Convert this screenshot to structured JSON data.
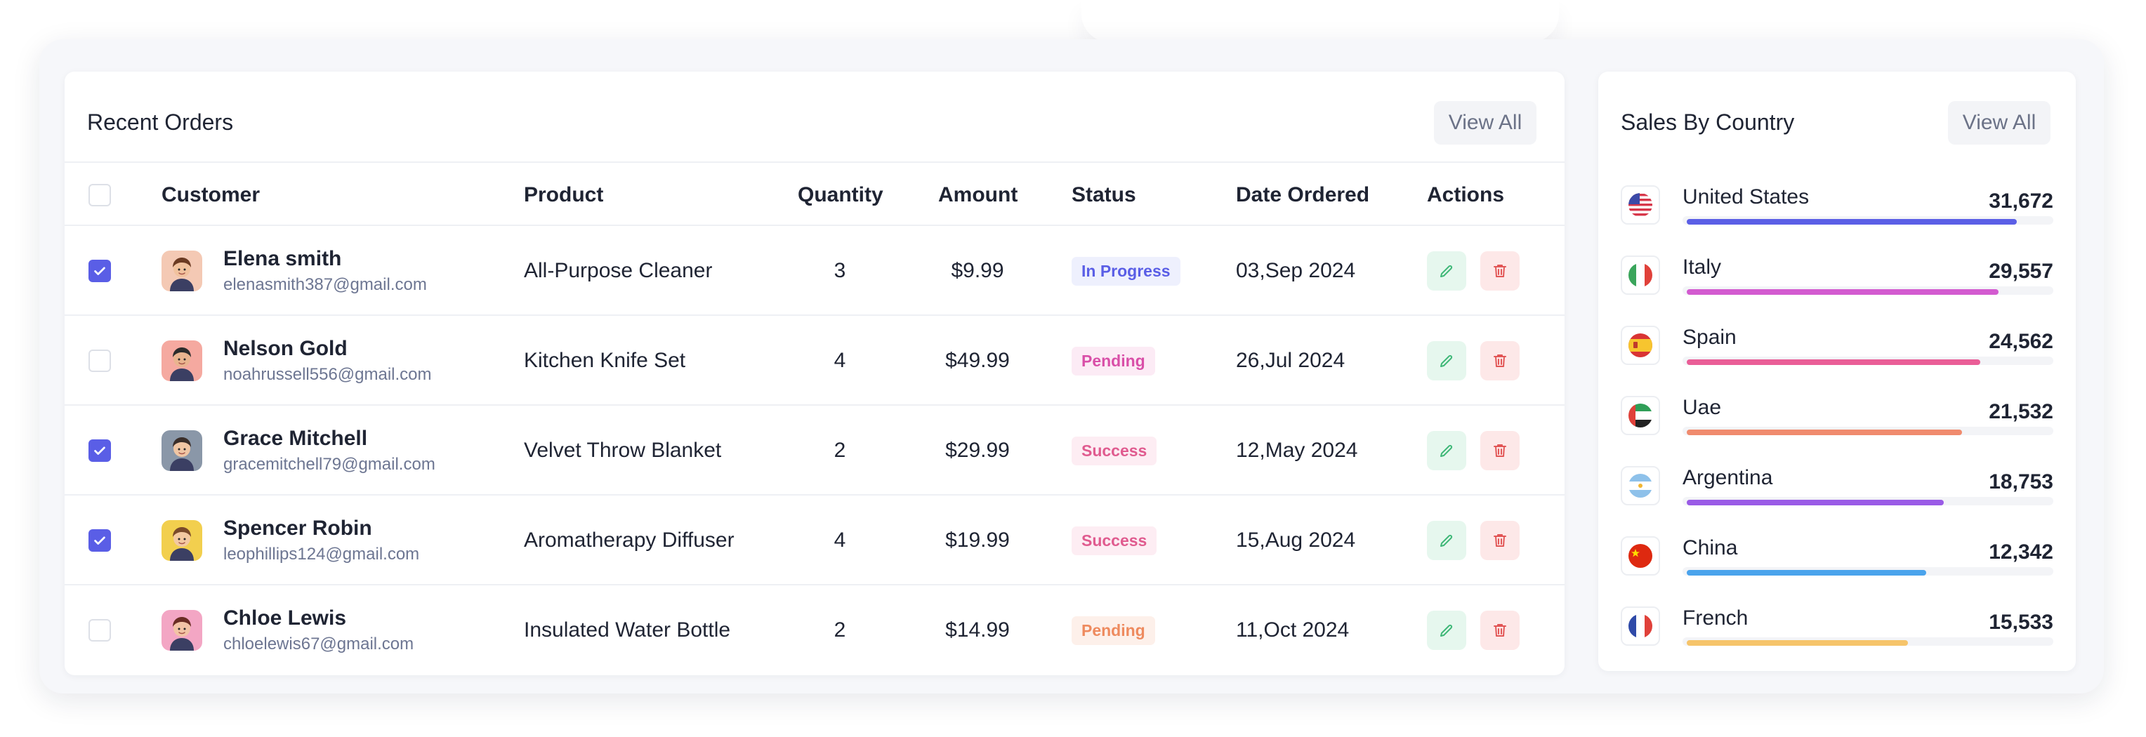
{
  "orders": {
    "title": "Recent Orders",
    "view_all": "View All",
    "columns": {
      "customer": "Customer",
      "product": "Product",
      "quantity": "Quantity",
      "amount": "Amount",
      "status": "Status",
      "date": "Date Ordered",
      "actions": "Actions"
    },
    "rows": [
      {
        "checked": true,
        "name": "Elena smith",
        "email": "elenasmith387@gmail.com",
        "product": "All-Purpose Cleaner",
        "quantity": "3",
        "amount": "$9.99",
        "status": "In Progress",
        "status_color": "#5a5ee6",
        "status_bg": "#eef0fd",
        "date": "03,Sep 2024",
        "avatar_bg": "#f4c9b4"
      },
      {
        "checked": false,
        "name": "Nelson Gold",
        "email": "noahrussell556@gmail.com",
        "product": "Kitchen Knife Set",
        "quantity": "4",
        "amount": "$49.99",
        "status": "Pending",
        "status_color": "#d94fa8",
        "status_bg": "#fcebf5",
        "date": "26,Jul 2024",
        "avatar_bg": "#f5a9a0"
      },
      {
        "checked": true,
        "name": "Grace Mitchell",
        "email": "gracemitchell79@gmail.com",
        "product": "Velvet Throw Blanket",
        "quantity": "2",
        "amount": "$29.99",
        "status": "Success",
        "status_color": "#e05b8f",
        "status_bg": "#fdedf3",
        "date": "12,May 2024",
        "avatar_bg": "#8a97a8"
      },
      {
        "checked": true,
        "name": "Spencer Robin",
        "email": "leophillips124@gmail.com",
        "product": "Aromatherapy Diffuser",
        "quantity": "4",
        "amount": "$19.99",
        "status": "Success",
        "status_color": "#e05b8f",
        "status_bg": "#fdedf3",
        "date": "15,Aug 2024",
        "avatar_bg": "#f2cf4e"
      },
      {
        "checked": false,
        "name": "Chloe Lewis",
        "email": "chloelewis67@gmail.com",
        "product": "Insulated Water Bottle",
        "quantity": "2",
        "amount": "$14.99",
        "status": "Pending",
        "status_color": "#ee8a5e",
        "status_bg": "#fdf0ea",
        "date": "11,Oct 2024",
        "avatar_bg": "#f3a6c4"
      }
    ]
  },
  "countries": {
    "title": "Sales By Country",
    "view_all": "View All",
    "items": [
      {
        "name": "United States",
        "value": "31,672",
        "fill": 0.91,
        "color": "#5b5fe6",
        "flag": "us-flag-icon"
      },
      {
        "name": "Italy",
        "value": "29,557",
        "fill": 0.86,
        "color": "#d35bd0",
        "flag": "italy-flag-icon"
      },
      {
        "name": "Spain",
        "value": "24,562",
        "fill": 0.81,
        "color": "#ea5e97",
        "flag": "spain-flag-icon"
      },
      {
        "name": "Uae",
        "value": "21,532",
        "fill": 0.76,
        "color": "#f08b6e",
        "flag": "uae-flag-icon"
      },
      {
        "name": "Argentina",
        "value": "18,753",
        "fill": 0.71,
        "color": "#9a5be6",
        "flag": "argentina-flag-icon"
      },
      {
        "name": "China",
        "value": "12,342",
        "fill": 0.66,
        "color": "#4aa3ec",
        "flag": "china-flag-icon"
      },
      {
        "name": "French",
        "value": "15,533",
        "fill": 0.61,
        "color": "#f6c46a",
        "flag": "france-flag-icon"
      }
    ]
  }
}
